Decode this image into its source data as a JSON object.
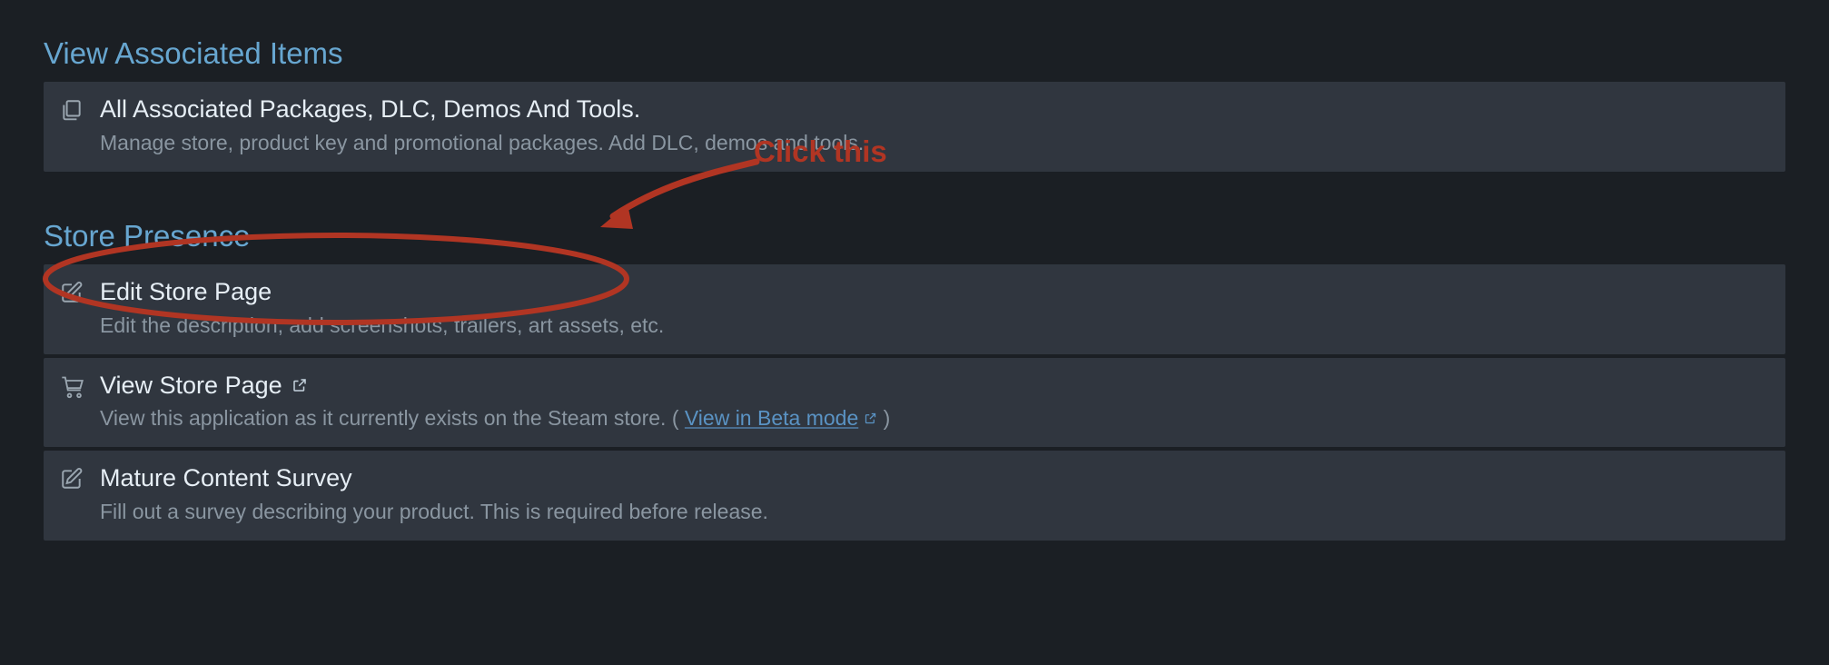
{
  "sections": {
    "associated": {
      "title": "View Associated Items",
      "items": [
        {
          "title": "All Associated Packages, DLC, Demos And Tools.",
          "sub": "Manage store, product key and promotional packages. Add DLC, demos and tools."
        }
      ]
    },
    "store_presence": {
      "title": "Store Presence",
      "items": {
        "edit": {
          "title": "Edit Store Page",
          "sub": "Edit the description, add screenshots, trailers, art assets, etc."
        },
        "view": {
          "title": "View Store Page",
          "sub_prefix": "View this application as it currently exists on the Steam store. ( ",
          "beta_link": "View in Beta mode",
          "sub_suffix": " )"
        },
        "mature": {
          "title": "Mature Content Survey",
          "sub": "Fill out a survey describing your product. This is required before release."
        }
      }
    }
  },
  "annotation": {
    "label": "Click this"
  }
}
